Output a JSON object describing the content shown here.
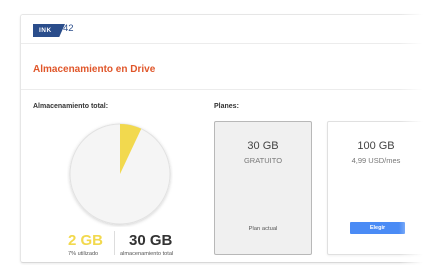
{
  "header": {
    "logo_badge": "INK",
    "logo_number": "42"
  },
  "page": {
    "title": "Almacenamiento en Drive"
  },
  "storage": {
    "section_label": "Almacenamiento total:",
    "used_value": "2 GB",
    "used_caption": "7% utilizado",
    "used_fraction": 0.07,
    "total_value": "30 GB",
    "total_caption": "almacenamiento total",
    "colors": {
      "used": "#f2d94e",
      "free": "#f5f5f5",
      "used_text": "#f2d94e"
    }
  },
  "plans": {
    "section_label": "Planes:",
    "items": [
      {
        "size": "30 GB",
        "subtitle": "GRATUITO",
        "status": "Plan actual"
      },
      {
        "size": "100 GB",
        "subtitle": "4,99 USD/mes",
        "button": "Elegir"
      }
    ],
    "colors": {
      "button": "#4a8bf5"
    }
  }
}
